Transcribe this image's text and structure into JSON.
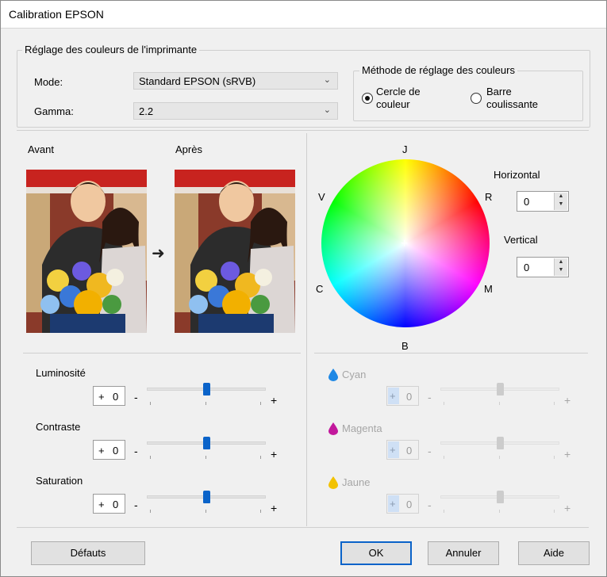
{
  "window": {
    "title": "Calibration EPSON"
  },
  "printer_colors": {
    "legend": "Réglage des couleurs de l'imprimante",
    "mode_label": "Mode:",
    "mode_value": "Standard EPSON (sRVB)",
    "gamma_label": "Gamma:",
    "gamma_value": "2.2"
  },
  "method": {
    "legend": "Méthode de réglage des couleurs",
    "option1_line1": "Cercle de",
    "option1_line2": "couleur",
    "option2_line1": "Barre",
    "option2_line2": "coulissante",
    "selected": "option1"
  },
  "preview": {
    "before_label": "Avant",
    "after_label": "Après",
    "arrow": "➜"
  },
  "wheel": {
    "top": "J",
    "left": "V",
    "right": "R",
    "lower_left": "C",
    "lower_right": "M",
    "bottom": "B",
    "horizontal_label": "Horizontal",
    "horizontal_value": "0",
    "vertical_label": "Vertical",
    "vertical_value": "0"
  },
  "adjustments": [
    {
      "label": "Luminosité",
      "sign": "+",
      "value": "0",
      "minus": "-",
      "plus": "+",
      "position": 0.5
    },
    {
      "label": "Contraste",
      "sign": "+",
      "value": "0",
      "minus": "-",
      "plus": "+",
      "position": 0.5
    },
    {
      "label": "Saturation",
      "sign": "+",
      "value": "0",
      "minus": "-",
      "plus": "+",
      "position": 0.5
    }
  ],
  "colors": [
    {
      "label": "Cyan",
      "sign": "+",
      "value": "0",
      "minus": "-",
      "plus": "+",
      "drop_color": "#1e88e5",
      "position": 0.5
    },
    {
      "label": "Magenta",
      "sign": "+",
      "value": "0",
      "minus": "-",
      "plus": "+",
      "drop_color": "#c2189c",
      "position": 0.5
    },
    {
      "label": "Jaune",
      "sign": "+",
      "value": "0",
      "minus": "-",
      "plus": "+",
      "drop_color": "#f2c200",
      "position": 0.5
    }
  ],
  "buttons": {
    "defaults": "Défauts",
    "ok": "OK",
    "cancel": "Annuler",
    "help": "Aide"
  },
  "accent_color": "#0a63c9"
}
